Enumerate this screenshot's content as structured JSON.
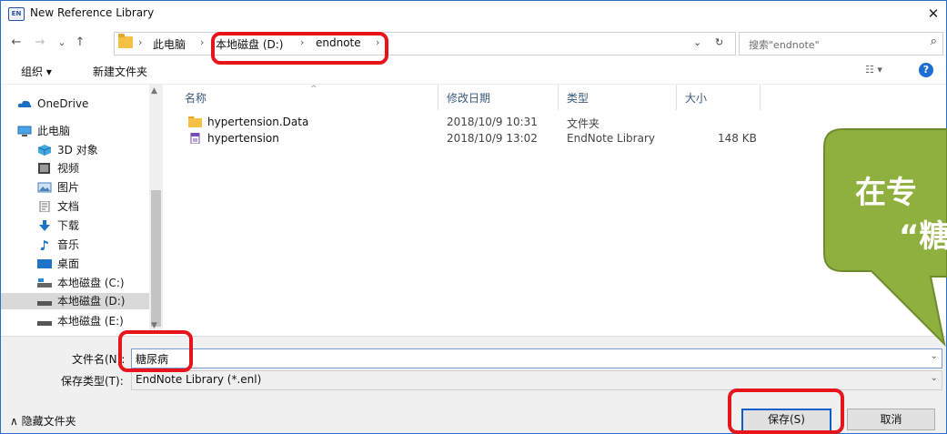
{
  "window": {
    "app_icon": "EN",
    "title": "New Reference Library",
    "close": "✕"
  },
  "nav": {
    "back": "←",
    "forward": "→",
    "recent": "⌄",
    "up": "↑",
    "breadcrumbs": [
      "此电脑",
      "本地磁盘 (D:)",
      "endnote"
    ],
    "sep": "›",
    "refresh": "↻",
    "dropdown": "⌄",
    "search_placeholder": "搜索\"endnote\""
  },
  "commands": {
    "organize": "组织 ▾",
    "new_folder": "新建文件夹",
    "view": "☷ ▾",
    "help": "?"
  },
  "sidebar": {
    "items": [
      {
        "label": "OneDrive",
        "icon": "cloud-icon"
      },
      {
        "label": "此电脑",
        "icon": "computer-icon"
      },
      {
        "label": "3D 对象",
        "icon": "cube-icon"
      },
      {
        "label": "视频",
        "icon": "video-icon"
      },
      {
        "label": "图片",
        "icon": "picture-icon"
      },
      {
        "label": "文档",
        "icon": "document-icon"
      },
      {
        "label": "下载",
        "icon": "download-icon"
      },
      {
        "label": "音乐",
        "icon": "music-icon"
      },
      {
        "label": "桌面",
        "icon": "desktop-icon"
      },
      {
        "label": "本地磁盘 (C:)",
        "icon": "drive-icon"
      },
      {
        "label": "本地磁盘 (D:)",
        "icon": "drive-icon",
        "selected": true
      },
      {
        "label": "本地磁盘 (E:)",
        "icon": "drive-icon"
      }
    ]
  },
  "columns": {
    "name": "名称",
    "modified": "修改日期",
    "type": "类型",
    "size": "大小"
  },
  "files": [
    {
      "name": "hypertension.Data",
      "modified": "2018/10/9 10:31",
      "type": "文件夹",
      "size": "",
      "icon": "folder-icon"
    },
    {
      "name": "hypertension",
      "modified": "2018/10/9 13:02",
      "type": "EndNote Library",
      "size": "148 KB",
      "icon": "endnote-file-icon"
    }
  ],
  "form": {
    "filename_label": "文件名(N):",
    "filename_value": "糖尿病",
    "filetype_label": "保存类型(T):",
    "filetype_value": "EndNote Library (*.enl)"
  },
  "footer": {
    "hide_folders": "∧ 隐藏文件夹",
    "save": "保存(S)",
    "cancel": "取消"
  },
  "callout": {
    "line1": "在专",
    "line2": "“糖"
  },
  "colors": {
    "accent": "#0a60c8",
    "highlight": "#e8141c",
    "callout_fill": "#8fb03e",
    "callout_border": "#6f8c2c",
    "selection": "#d9d9d9"
  }
}
